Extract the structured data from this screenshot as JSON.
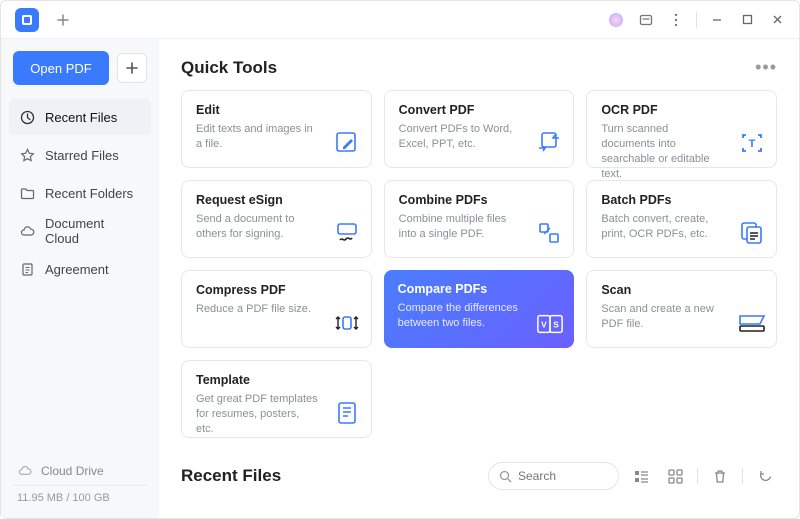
{
  "header": {
    "open_pdf": "Open PDF"
  },
  "nav": {
    "items": [
      {
        "label": "Recent Files"
      },
      {
        "label": "Starred Files"
      },
      {
        "label": "Recent Folders"
      },
      {
        "label": "Document Cloud"
      },
      {
        "label": "Agreement"
      }
    ],
    "cloud_drive": "Cloud Drive",
    "storage": "11.95 MB / 100 GB"
  },
  "sections": {
    "quick_tools": "Quick Tools",
    "recent_files": "Recent Files"
  },
  "search": {
    "placeholder": "Search"
  },
  "tools": [
    {
      "title": "Edit",
      "desc": "Edit texts and images in a file."
    },
    {
      "title": "Convert PDF",
      "desc": "Convert PDFs to Word, Excel, PPT, etc."
    },
    {
      "title": "OCR PDF",
      "desc": "Turn scanned documents into searchable or editable text."
    },
    {
      "title": "Request eSign",
      "desc": "Send a document to others for signing."
    },
    {
      "title": "Combine PDFs",
      "desc": "Combine multiple files into a single PDF."
    },
    {
      "title": "Batch PDFs",
      "desc": "Batch convert, create, print, OCR PDFs, etc."
    },
    {
      "title": "Compress PDF",
      "desc": "Reduce a PDF file size."
    },
    {
      "title": "Compare PDFs",
      "desc": "Compare the differences between two files."
    },
    {
      "title": "Scan",
      "desc": "Scan and create a new PDF file."
    },
    {
      "title": "Template",
      "desc": "Get great PDF templates for resumes, posters, etc."
    }
  ]
}
